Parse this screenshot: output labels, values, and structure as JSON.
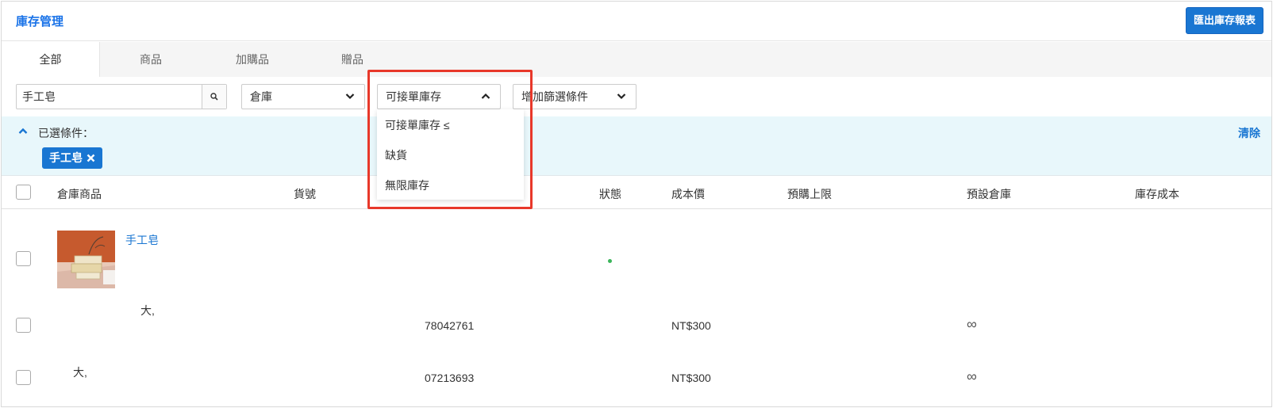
{
  "header": {
    "title": "庫存管理",
    "export_label": "匯出庫存報表"
  },
  "tabs": [
    {
      "label": "全部"
    },
    {
      "label": "商品"
    },
    {
      "label": "加購品"
    },
    {
      "label": "贈品"
    }
  ],
  "filters": {
    "search_value": "手工皂",
    "warehouse_label": "倉庫",
    "stock_filter_label": "可接單庫存",
    "add_filter_label": "增加篩選條件"
  },
  "dropdown": {
    "items": [
      "可接單庫存 ≤",
      "缺貨",
      "無限庫存"
    ]
  },
  "conditions": {
    "label": "已選條件：",
    "clear_label": "清除",
    "tags": [
      "手工皂"
    ]
  },
  "table": {
    "columns": [
      "倉庫商品",
      "貨號",
      "狀態",
      "成本價",
      "預購上限",
      "預設倉庫",
      "庫存成本"
    ],
    "product": {
      "name": "手工皂",
      "status_color": "#3bb55a"
    },
    "variants": [
      {
        "option": "大,",
        "sku": "78042761",
        "cost": "NT$300",
        "preorder_limit": "∞"
      },
      {
        "option": "大,",
        "sku": "07213693",
        "cost": "NT$300",
        "preorder_limit": "∞"
      }
    ]
  },
  "colors": {
    "accent": "#1976d2",
    "highlight": "#e8382a",
    "panel_bg": "#e8f7fb"
  }
}
